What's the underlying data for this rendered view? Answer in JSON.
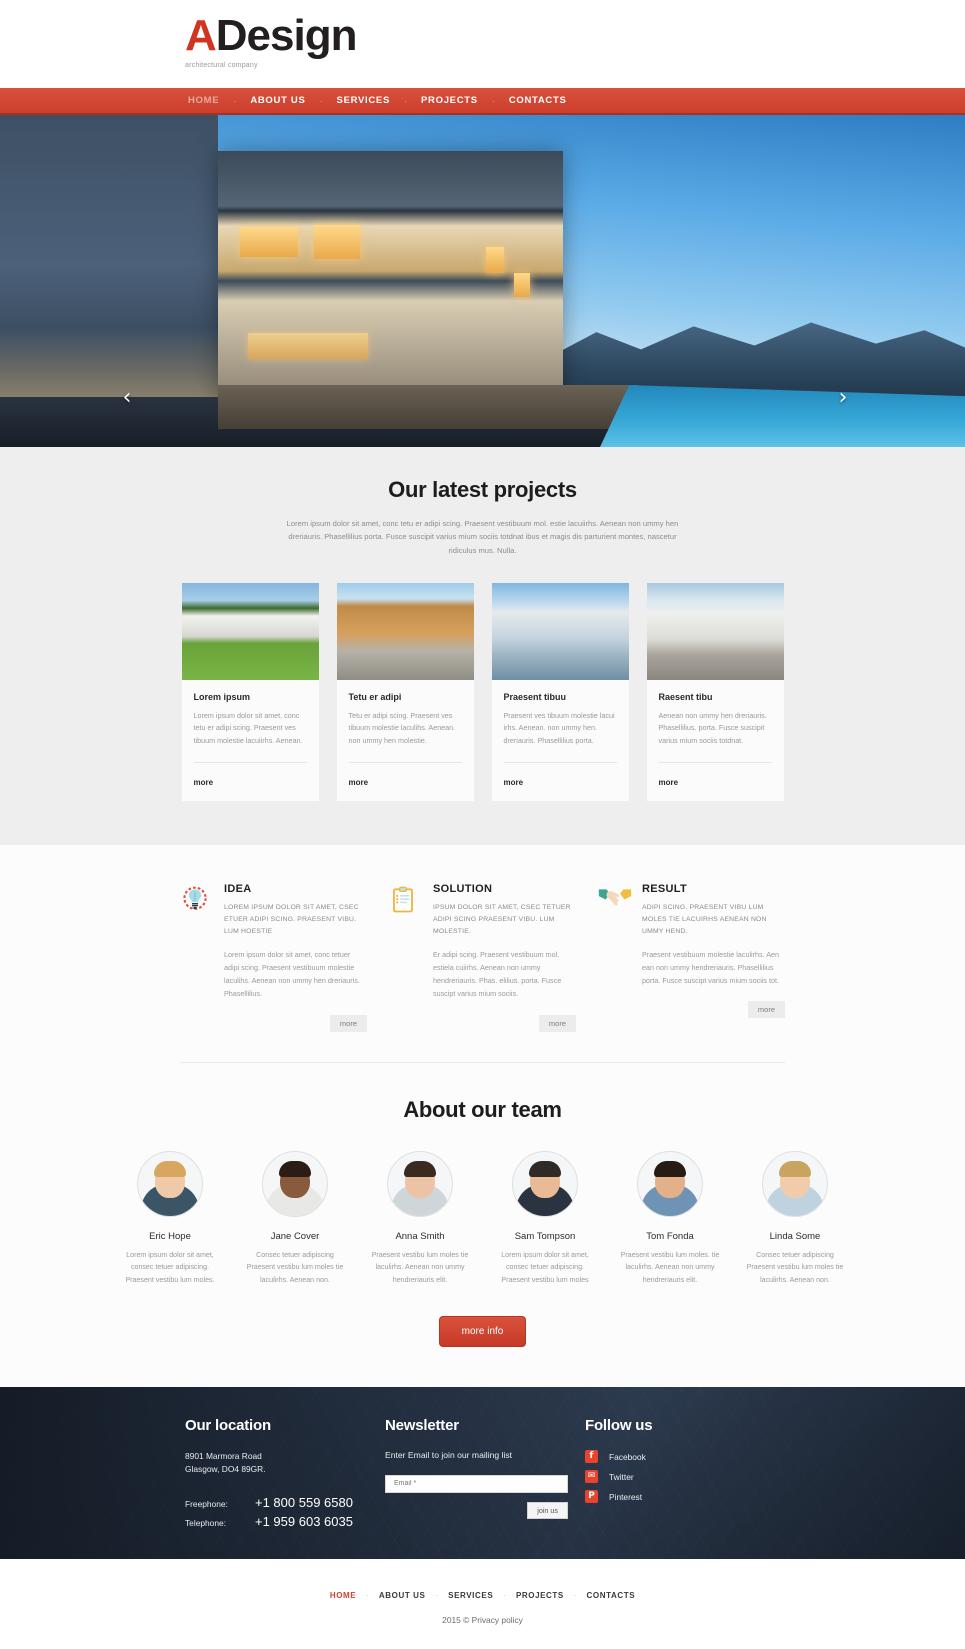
{
  "brand": {
    "logo_a": "A",
    "logo_rest": "Design",
    "tagline": "architectural company",
    "accent_color": "#cf4331",
    "logo_accent": "#cf3520"
  },
  "nav": {
    "items": [
      {
        "label": "HOME",
        "active": true
      },
      {
        "label": "ABOUT US",
        "active": false
      },
      {
        "label": "SERVICES",
        "active": false
      },
      {
        "label": "PROJECTS",
        "active": false
      },
      {
        "label": "CONTACTS",
        "active": false
      }
    ],
    "separator": "·"
  },
  "hero": {
    "prev_arrow": "‹",
    "next_arrow": "›"
  },
  "projects": {
    "title": "Our latest projects",
    "subtitle": "Lorem ipsum dolor sit amet, conc tetu er adipi scing. Praesent vestibuum mol. estie lacuiirhs. Aenean non ummy hen dreriauris. Phasellilius porta. Fusce suscipit varius mium sociis totdnat ibus et magis dis parturient montes, nascetur ridiculus mus. Nulla.",
    "more_label": "more",
    "cards": [
      {
        "title": "Lorem ipsum",
        "text": "Lorem ipsum dolor sit amet, conc tetu er adipi scing. Praesent ves tibuum molestie lacuiirhs. Aenean."
      },
      {
        "title": "Tetu er adipi",
        "text": "Tetu er adipi scing. Praesent ves tibuum molestie laculihs. Aenean. non ummy hen molestie."
      },
      {
        "title": "Praesent tibuu",
        "text": "Praesent ves tibuum molestie lacui irhs. Aenean. non ummy hen. dreriauris. Phasellilius porta."
      },
      {
        "title": "Raesent  tibu",
        "text": "Aenean non ummy hen dreriauris. Phasellilius. porta. Fusce suscipit varius mium sociis totdnat."
      }
    ]
  },
  "services": {
    "more_label": "more",
    "items": [
      {
        "icon": "lightbulb-icon",
        "title": "IDEA",
        "caps": "LOREM IPSUM DOLOR SIT AMET, CSEC ETUER ADIPI SCING. PRAESENT VIBU. LUM HOESTIE",
        "body": "Lorem ipsum dolor sit amet, conc tetuer adipi scing. Praesent vestibuum molestie laculihs. Aenean non ummy hen dreriauris. Phasellilius."
      },
      {
        "icon": "clipboard-icon",
        "title": "SOLUTION",
        "caps": "IPSUM DOLOR SIT AMET, CSEC TETUER ADIPI SCING PRAESENT VIBU. LUM MOLESTIE.",
        "body": "Er adipi scing. Praesent vestibuum mol. estiela cuiirhs. Aenean non ummy hendreriauris. Phas. elilius. porta. Fusce suscipt varius mium sociis."
      },
      {
        "icon": "handshake-icon",
        "title": "RESULT",
        "caps": "ADIPI SCING. PRAESENT VIBU LUM MOLES TIE LACUIRHS AENEAN NON UMMY HEND.",
        "body": "Praesent vestibuum molestie laculirhs. Aen ean non ummy hendreriauris. Phasellilius porta. Fusce suscipt varius mium sociis tot."
      }
    ]
  },
  "team": {
    "title": "About our team",
    "cta_label": "more info",
    "members": [
      {
        "name": "Eric Hope",
        "text": "Lorem ipsum dolor sit amet, consec tetuer adipiscing. Praesent vestibu lum moles.",
        "skin": "#f0c9a8",
        "hair": "#d8a75f",
        "cloth": "#3b5566"
      },
      {
        "name": "Jane Cover",
        "text": "Consec tetuer adipiscing Praesent vestibu lum moles tie laculirhs. Aenean non.",
        "skin": "#8a5a3c",
        "hair": "#2b1d16",
        "cloth": "#e8e8e6"
      },
      {
        "name": "Anna Smith",
        "text": "Praesent vestibu lum moles tie laculirhs. Aenean non ummy hendreriauris elit.",
        "skin": "#ecc3a4",
        "hair": "#3a2a20",
        "cloth": "#cfd6da"
      },
      {
        "name": "Sam Tompson",
        "text": "Lorem ipsum dolor sit amet, consec tetuer adipiscing. Praesent vestibu lum moles",
        "skin": "#e8bb96",
        "hair": "#2f2a26",
        "cloth": "#2a3440"
      },
      {
        "name": "Tom Fonda",
        "text": "Praesent vestibu lum moles. tie laculirhs. Aenean non ummy hendreriauris elit.",
        "skin": "#e4b089",
        "hair": "#271c14",
        "cloth": "#6f93b5"
      },
      {
        "name": "Linda Some",
        "text": "Consec tetuer adipiscing Praesent vestibu lum moles tie laculirhs. Aenean non.",
        "skin": "#f2cbaa",
        "hair": "#c8a45e",
        "cloth": "#bfd2e0"
      }
    ]
  },
  "footer": {
    "location": {
      "title": "Our location",
      "address_line1": "8901 Marmora Road",
      "address_line2": "Glasgow, DO4 89GR.",
      "freephone_label": "Freephone:",
      "freephone_value": "+1 800 559 6580",
      "telephone_label": "Telephone:",
      "telephone_value": "+1 959 603 6035"
    },
    "newsletter": {
      "title": "Newsletter",
      "description": "Enter Email to join our mailing list",
      "email_placeholder": "Email *",
      "email_value": "",
      "submit_label": "join us"
    },
    "follow": {
      "title": "Follow us",
      "links": [
        {
          "label": "Facebook",
          "glyph": "f",
          "icon": "facebook-icon"
        },
        {
          "label": "Twitter",
          "glyph": "✉",
          "icon": "twitter-icon"
        },
        {
          "label": "Pinterest",
          "glyph": "P",
          "icon": "pinterest-icon"
        }
      ]
    }
  },
  "bottom": {
    "nav": [
      {
        "label": "HOME",
        "active": true
      },
      {
        "label": "ABOUT US",
        "active": false
      },
      {
        "label": "SERVICES",
        "active": false
      },
      {
        "label": "PROJECTS",
        "active": false
      },
      {
        "label": "CONTACTS",
        "active": false
      }
    ],
    "separator": "·",
    "copyright": "2015 © Privacy policy"
  }
}
